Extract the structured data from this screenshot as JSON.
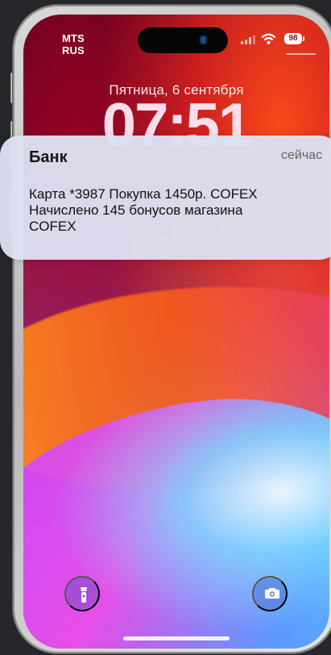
{
  "status_bar": {
    "carrier": "MTS RUS",
    "battery_level": "98",
    "signal_icon": "cellular-signal-icon",
    "wifi_icon": "wifi-icon"
  },
  "lock_screen": {
    "date": "Пятница, 6 сентября",
    "time": "07:51"
  },
  "notification": {
    "app_name": "Банк",
    "time": "сейчас",
    "message_lines": [
      "Карта *3987 Покупка 1450р. COFEX",
      "Начислено 145 бонусов магазина",
      "COFEX"
    ]
  },
  "controls": {
    "flashlight_icon": "flashlight-icon",
    "camera_icon": "camera-icon"
  },
  "colors": {
    "notification_background": "#dde1f1",
    "battery_text": "#7e1024",
    "wallpaper_red": "#8a0d31",
    "wallpaper_orange": "#ef6b16",
    "wallpaper_purple": "#a548e3",
    "wallpaper_cyan": "#3fd7ff"
  }
}
